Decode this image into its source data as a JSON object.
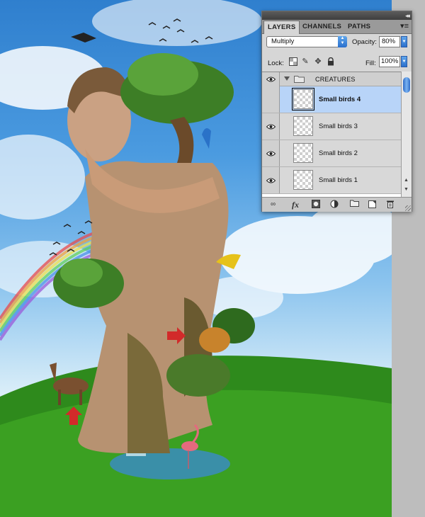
{
  "panel": {
    "tabs": [
      "LAYERS",
      "CHANNELS",
      "PATHS"
    ],
    "active_tab": "LAYERS",
    "blend_mode": "Multiply",
    "opacity_label": "Opacity:",
    "opacity_value": "80%",
    "lock_label": "Lock:",
    "fill_label": "Fill:",
    "fill_value": "100%",
    "group": {
      "name": "CREATURES",
      "expanded": true
    },
    "layers": [
      {
        "name": "Small birds 4",
        "selected": true,
        "visible": false
      },
      {
        "name": "Small birds 3",
        "selected": false,
        "visible": true
      },
      {
        "name": "Small birds 2",
        "selected": false,
        "visible": true
      },
      {
        "name": "Small birds 1",
        "selected": false,
        "visible": true
      }
    ],
    "footer_fx": "fx",
    "icons": {
      "lock_buttons": [
        "lock-transparency-icon",
        "lock-paint-icon",
        "lock-position-icon",
        "lock-all-icon"
      ],
      "footer": [
        "link-layers-icon",
        "layer-style-icon",
        "add-mask-icon",
        "adjustment-layer-icon",
        "new-group-icon",
        "new-layer-icon",
        "trash-icon"
      ]
    }
  },
  "colors": {
    "selection": "#b8d4f8",
    "accent_blue": "#2a6fcc"
  }
}
